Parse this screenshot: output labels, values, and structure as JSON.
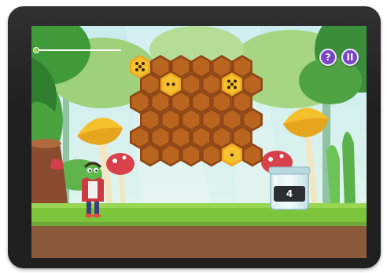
{
  "game": {
    "help_button": {
      "label": "?",
      "icon": "question-icon"
    },
    "pause_button": {
      "label": "II",
      "icon": "pause-icon"
    },
    "progress": {
      "fraction": 0.0
    },
    "jar": {
      "count": "4"
    },
    "honeycomb": {
      "highlighted_cells": [
        {
          "row": 0,
          "col": 0,
          "dots": 5
        },
        {
          "row": 1,
          "col": 1,
          "dots": 2
        },
        {
          "row": 1,
          "col": 4,
          "dots": 5
        },
        {
          "row": 5,
          "col": 4,
          "dots": 1
        }
      ]
    }
  },
  "colors": {
    "sky": "#bfe7ea",
    "grass": "#7cc43a",
    "honey": "#b9651f",
    "highlight": "#f6c12e",
    "hud": "#7a45c7"
  }
}
